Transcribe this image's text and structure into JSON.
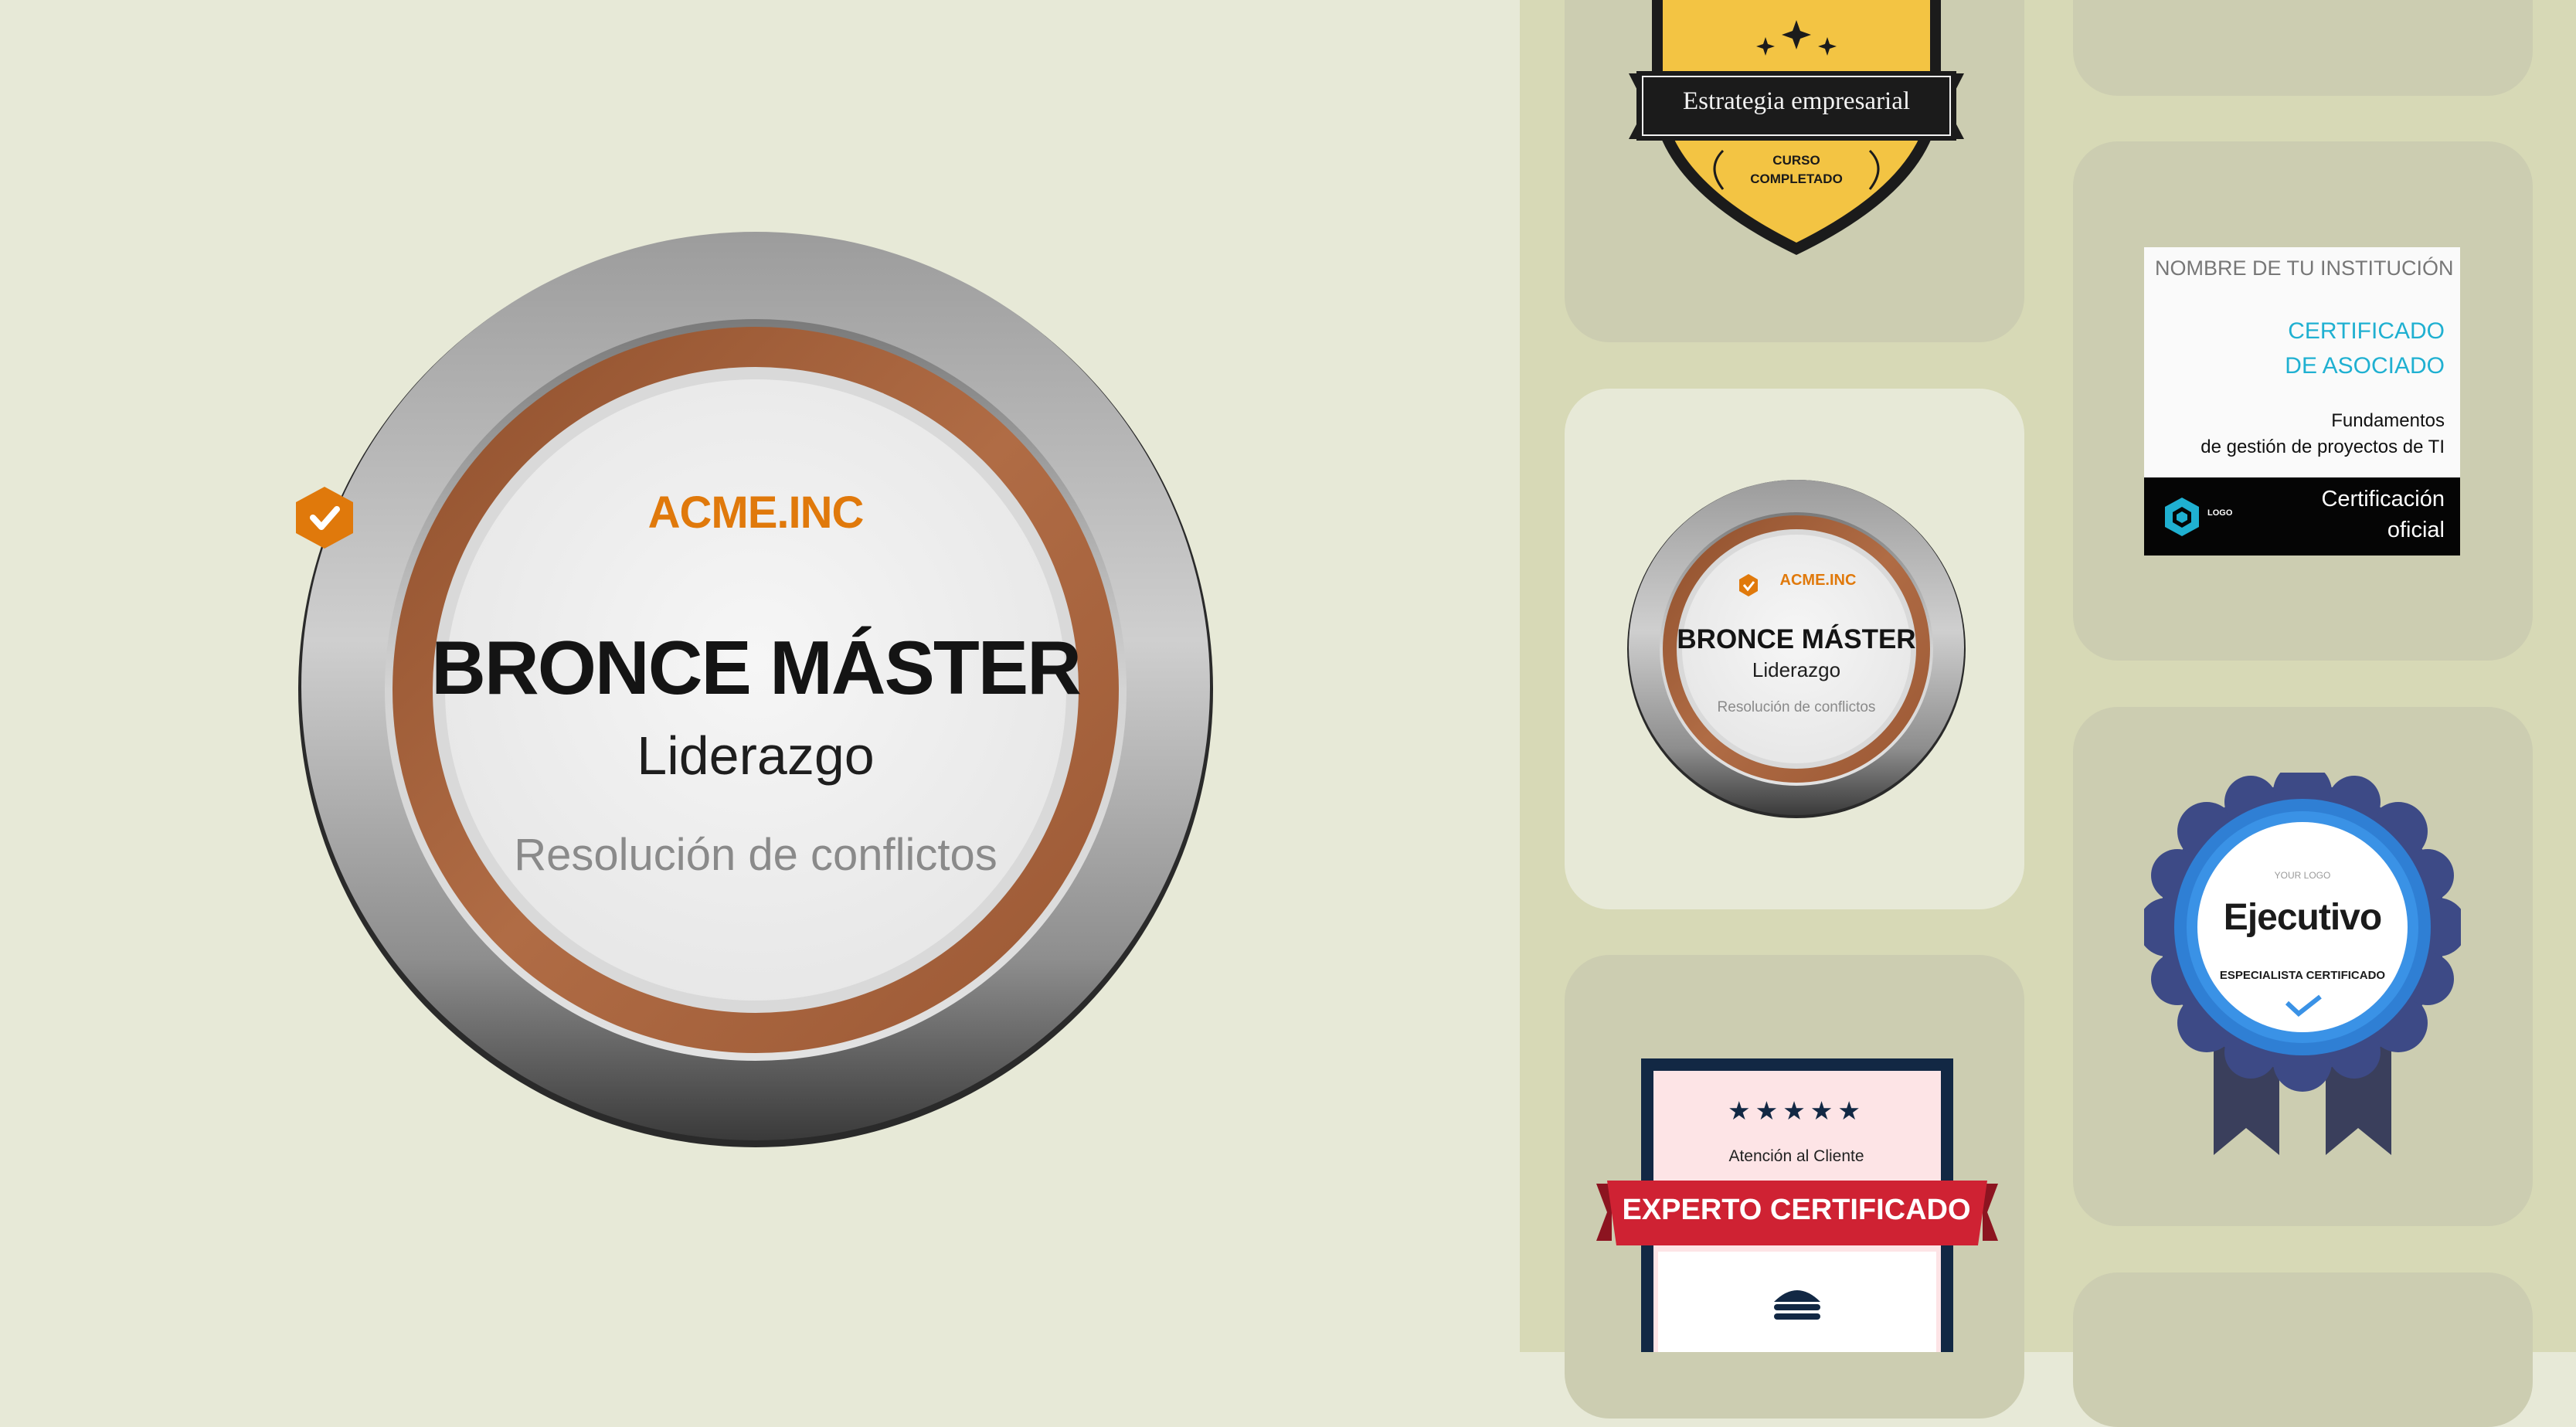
{
  "hero_badge": {
    "logo_text": "ACME.INC",
    "title": "BRONCE MÁSTER",
    "subtitle": "Liderazgo",
    "description": "Resolución de conflictos"
  },
  "gallery": {
    "shield_badge": {
      "ribbon_text": "Estrategia empresarial",
      "bottom_text_line1": "CURSO",
      "bottom_text_line2": "COMPLETADO"
    },
    "certificate": {
      "institution": "NOMBRE DE TU INSTITUCIÓN",
      "title_line1": "CERTIFICADO",
      "title_line2": "DE ASOCIADO",
      "course_line1": "Fundamentos",
      "course_line2": "de gestión de proyectos de TI",
      "logo_text": "LOGO",
      "footer_line1": "Certificación",
      "footer_line2": "oficial"
    },
    "small_medal": {
      "logo_text": "ACME.INC",
      "title": "BRONCE MÁSTER",
      "subtitle": "Liderazgo",
      "description": "Resolución de conflictos"
    },
    "rosette": {
      "logo_text": "YOUR LOGO",
      "title": "Ejecutivo",
      "subtitle": "ESPECIALISTA CERTIFICADO"
    },
    "expert_badge": {
      "stars": "★★★★★",
      "subtitle": "Atención al Cliente",
      "ribbon_text": "EXPERTO CERTIFICADO"
    }
  },
  "colors": {
    "background": "#e7e9d7",
    "gallery_strip": "#d7d9b6",
    "card": "#cccdb1",
    "bronze": "#9c5a35",
    "acme_orange": "#e0790b",
    "shield_gold": "#f3c443",
    "cert_cyan": "#1fb0d1",
    "rosette_blue": "#2f7fd4",
    "expert_red": "#cf2233",
    "expert_navy": "#122844"
  }
}
